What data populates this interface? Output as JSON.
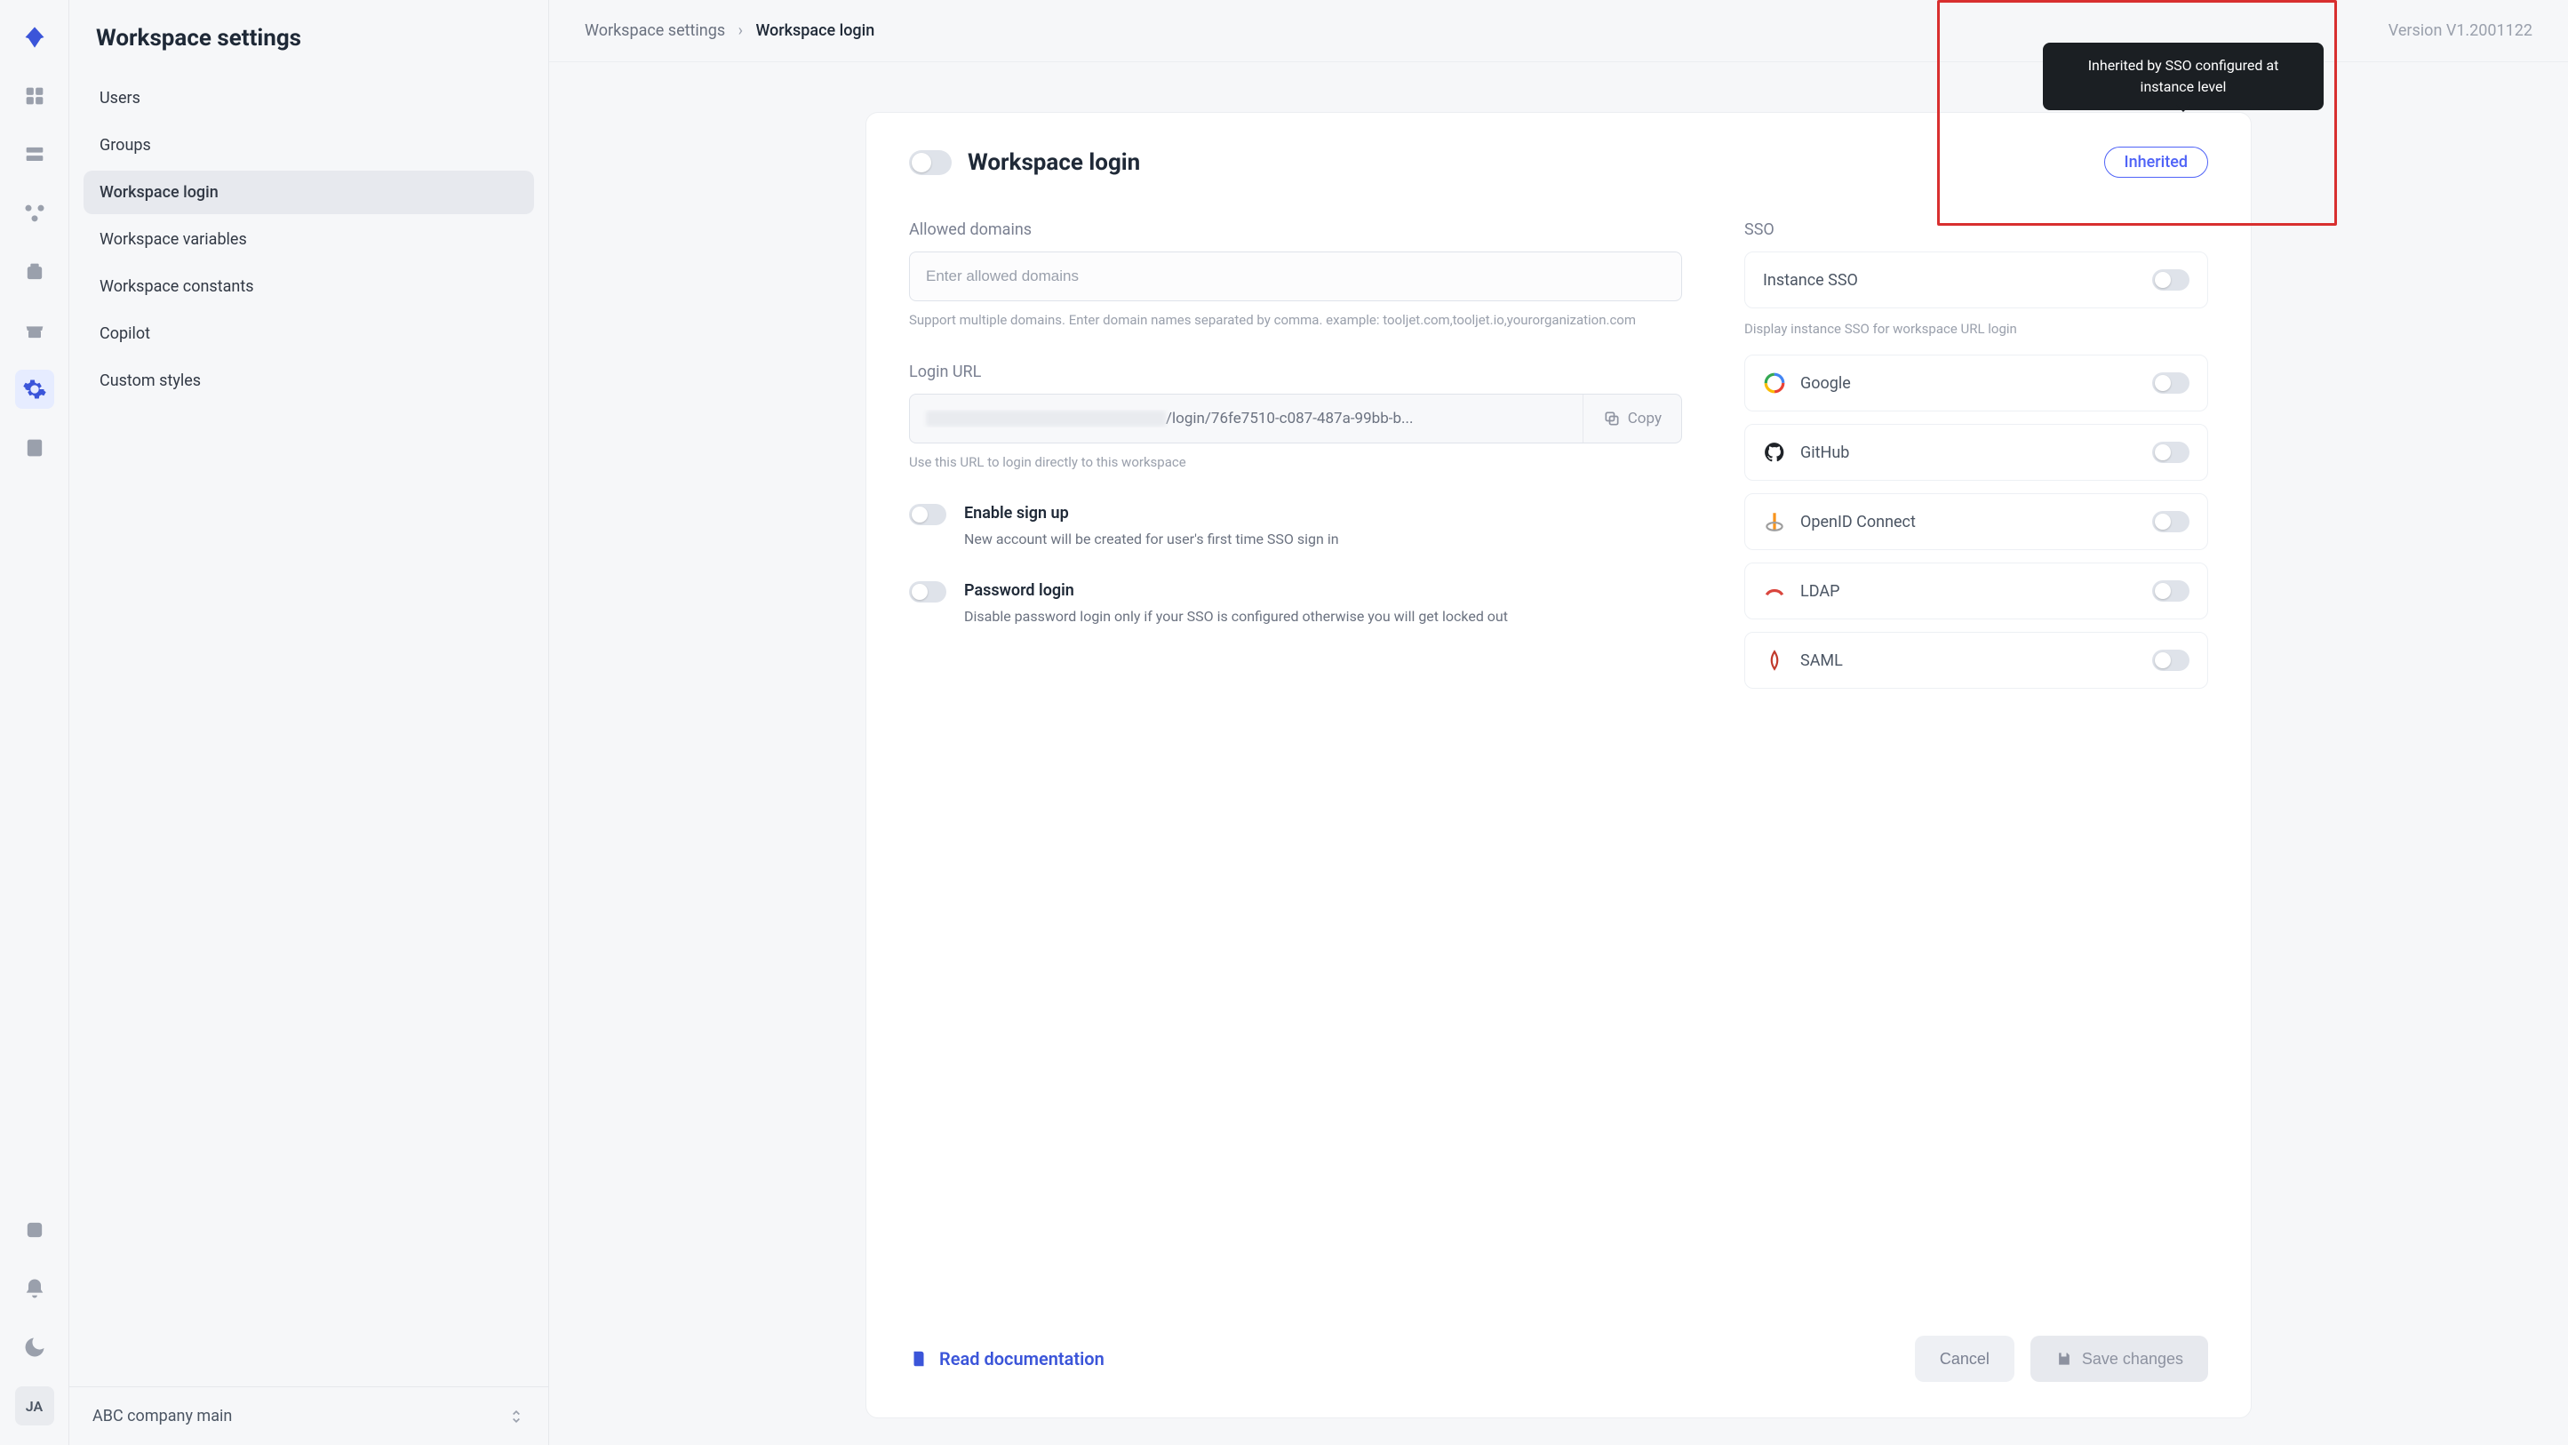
{
  "iconRail": {
    "avatar": "JA"
  },
  "secondaryNav": {
    "title": "Workspace settings",
    "items": [
      {
        "label": "Users"
      },
      {
        "label": "Groups"
      },
      {
        "label": "Workspace login"
      },
      {
        "label": "Workspace variables"
      },
      {
        "label": "Workspace constants"
      },
      {
        "label": "Copilot"
      },
      {
        "label": "Custom styles"
      }
    ],
    "workspace": "ABC company main"
  },
  "breadcrumb": {
    "root": "Workspace settings",
    "current": "Workspace login"
  },
  "version": "Version V1.2001122",
  "header": {
    "title": "Workspace login",
    "pill": "Inherited"
  },
  "tooltip": "Inherited by SSO configured at instance level",
  "allowedDomains": {
    "label": "Allowed domains",
    "placeholder": "Enter allowed domains",
    "helper": "Support multiple domains. Enter domain names separated by comma. example: tooljet.com,tooljet.io,yourorganization.com"
  },
  "loginUrl": {
    "label": "Login URL",
    "valueSuffix": "/login/76fe7510-c087-487a-99bb-b...",
    "copy": "Copy",
    "helper": "Use this URL to login directly to this workspace"
  },
  "options": {
    "signup": {
      "title": "Enable sign up",
      "desc": "New account will be created for user's first time SSO sign in"
    },
    "password": {
      "title": "Password login",
      "desc": "Disable password login only if your SSO is configured otherwise you will get locked out"
    }
  },
  "sso": {
    "label": "SSO",
    "instance": "Instance SSO",
    "helper": "Display instance SSO for workspace URL login",
    "items": [
      {
        "name": "Google"
      },
      {
        "name": "GitHub"
      },
      {
        "name": "OpenID Connect"
      },
      {
        "name": "LDAP"
      },
      {
        "name": "SAML"
      }
    ]
  },
  "footer": {
    "doc": "Read documentation",
    "cancel": "Cancel",
    "save": "Save changes"
  }
}
